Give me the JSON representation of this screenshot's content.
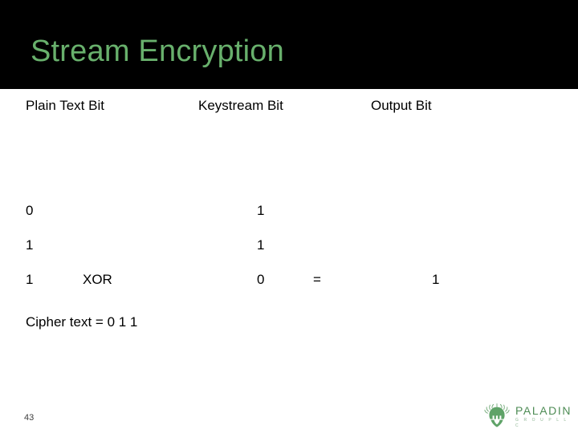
{
  "slide": {
    "title": "Stream Encryption",
    "title_color": "#68b06c",
    "band_color": "#000000",
    "background_color": "#ffffff"
  },
  "table": {
    "headers": {
      "plain_text_bit": "Plain Text Bit",
      "keystream_bit": "Keystream Bit",
      "output_bit": "Output Bit"
    },
    "rows": [
      {
        "plain": "0",
        "operator": "",
        "keystream": "1",
        "equals": "",
        "output": ""
      },
      {
        "plain": "1",
        "operator": "",
        "keystream": "1",
        "equals": "",
        "output": ""
      },
      {
        "plain": "1",
        "operator": "XOR",
        "keystream": "0",
        "equals": "=",
        "output": "1"
      }
    ]
  },
  "cipher": {
    "line": "Cipher text = 0 1 1"
  },
  "footer": {
    "page_number": "43",
    "logo_word": "PALADIN",
    "logo_sub": "G R O U P   L L C",
    "logo_icon": "paladin-helmet-icon",
    "logo_color": "#4e8c55"
  }
}
